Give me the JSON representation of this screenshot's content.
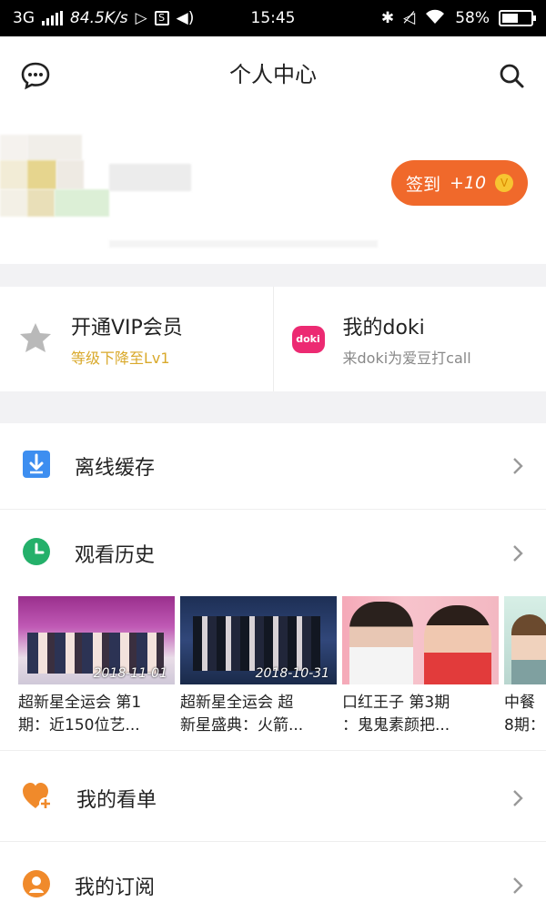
{
  "status_bar": {
    "network": "3G",
    "speed": "84.5K/s",
    "time": "15:45",
    "battery": "58%",
    "battery_level": 0.58
  },
  "header": {
    "title": "个人中心"
  },
  "profile": {
    "checkin_label": "签到",
    "checkin_bonus": "+10",
    "coin_symbol": "V"
  },
  "features": [
    {
      "title": "开通VIP会员",
      "subtitle": "等级下降至Lv1",
      "subtitle_color": "#d9a92b"
    },
    {
      "title": "我的doki",
      "subtitle": "来doki为爱豆打call",
      "subtitle_color": "#888888",
      "badge": "doki"
    }
  ],
  "rows": {
    "offline_cache": "离线缓存",
    "watch_history": "观看历史",
    "my_watchlist": "我的看单",
    "my_subscriptions": "我的订阅"
  },
  "history": [
    {
      "date": "2018-11-01",
      "title": "超新星全运会 第1\n期：近150位艺..."
    },
    {
      "date": "2018-10-31",
      "title": "超新星全运会 超\n新星盛典：火箭..."
    },
    {
      "date": "",
      "title": "口红王子 第3期\n：鬼鬼素颜把..."
    },
    {
      "date": "",
      "title": "中餐\n8期："
    }
  ],
  "colors": {
    "accent": "#f0692b",
    "download_icon": "#3d8ef0",
    "history_icon": "#24b06a",
    "watchlist_icon": "#f08a2b",
    "subscription_icon": "#f08a2b"
  }
}
